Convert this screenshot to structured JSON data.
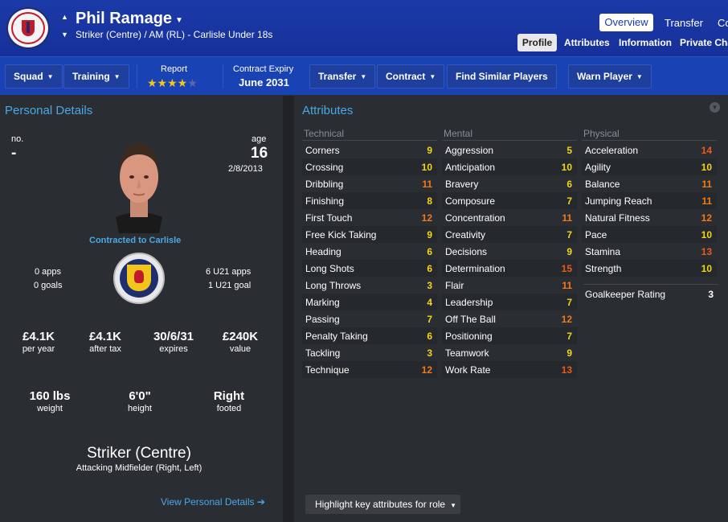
{
  "header": {
    "player_name": "Phil Ramage",
    "subtitle": "Striker (Centre) / AM (RL) - Carlisle Under 18s",
    "tabs": [
      "Overview",
      "Transfer",
      "Co"
    ],
    "subtabs": [
      "Profile",
      "Attributes",
      "Information",
      "Private Cha"
    ]
  },
  "toolbar": {
    "squad": "Squad",
    "training": "Training",
    "report_label": "Report",
    "report_stars": 4,
    "report_stars_max": 5,
    "contract_label": "Contract Expiry",
    "contract_value": "June 2031",
    "transfer": "Transfer",
    "contract": "Contract",
    "find_similar": "Find Similar Players",
    "warn_player": "Warn Player"
  },
  "personal": {
    "title": "Personal Details",
    "no_label": "no.",
    "no_value": "-",
    "age_label": "age",
    "age_value": "16",
    "dob": "2/8/2013",
    "contracted_to": "Contracted to Carlisle",
    "apps": "0 apps",
    "goals": "0 goals",
    "u21_apps": "6 U21 apps",
    "u21_goals": "1 U21 goal",
    "wage": "£4.1K",
    "wage_label": "per year",
    "after_tax": "£4.1K",
    "after_tax_label": "after tax",
    "expires": "30/6/31",
    "expires_label": "expires",
    "value": "£240K",
    "value_label": "value",
    "weight": "160 lbs",
    "weight_label": "weight",
    "height": "6'0\"",
    "height_label": "height",
    "foot": "Right",
    "foot_label": "footed",
    "position": "Striker (Centre)",
    "position_sub": "Attacking Midfielder (Right, Left)",
    "view_details": "View Personal Details ➔"
  },
  "attributes": {
    "title": "Attributes",
    "columns": [
      {
        "name": "Technical",
        "items": [
          {
            "name": "Corners",
            "value": 9
          },
          {
            "name": "Crossing",
            "value": 10
          },
          {
            "name": "Dribbling",
            "value": 11
          },
          {
            "name": "Finishing",
            "value": 8
          },
          {
            "name": "First Touch",
            "value": 12
          },
          {
            "name": "Free Kick Taking",
            "value": 9
          },
          {
            "name": "Heading",
            "value": 6
          },
          {
            "name": "Long Shots",
            "value": 6
          },
          {
            "name": "Long Throws",
            "value": 3
          },
          {
            "name": "Marking",
            "value": 4
          },
          {
            "name": "Passing",
            "value": 7
          },
          {
            "name": "Penalty Taking",
            "value": 6
          },
          {
            "name": "Tackling",
            "value": 3
          },
          {
            "name": "Technique",
            "value": 12
          }
        ]
      },
      {
        "name": "Mental",
        "items": [
          {
            "name": "Aggression",
            "value": 5
          },
          {
            "name": "Anticipation",
            "value": 10
          },
          {
            "name": "Bravery",
            "value": 6
          },
          {
            "name": "Composure",
            "value": 7
          },
          {
            "name": "Concentration",
            "value": 11
          },
          {
            "name": "Creativity",
            "value": 7
          },
          {
            "name": "Decisions",
            "value": 9
          },
          {
            "name": "Determination",
            "value": 15
          },
          {
            "name": "Flair",
            "value": 11
          },
          {
            "name": "Leadership",
            "value": 7
          },
          {
            "name": "Off The Ball",
            "value": 12
          },
          {
            "name": "Positioning",
            "value": 7
          },
          {
            "name": "Teamwork",
            "value": 9
          },
          {
            "name": "Work Rate",
            "value": 13
          }
        ]
      },
      {
        "name": "Physical",
        "items": [
          {
            "name": "Acceleration",
            "value": 14
          },
          {
            "name": "Agility",
            "value": 10
          },
          {
            "name": "Balance",
            "value": 11
          },
          {
            "name": "Jumping Reach",
            "value": 11
          },
          {
            "name": "Natural Fitness",
            "value": 12
          },
          {
            "name": "Pace",
            "value": 10
          },
          {
            "name": "Stamina",
            "value": 13
          },
          {
            "name": "Strength",
            "value": 10
          }
        ]
      }
    ],
    "gk_label": "Goalkeeper Rating",
    "gk_value": "3",
    "highlight_button": "Highlight key attributes for role"
  }
}
